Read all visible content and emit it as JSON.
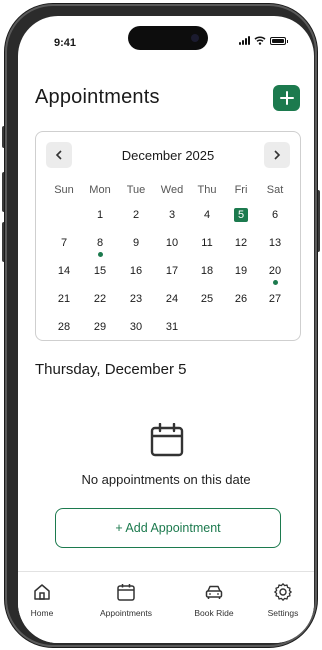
{
  "status_bar": {
    "time": "9:41"
  },
  "header": {
    "title": "Appointments",
    "add_icon": "plus-icon",
    "accent": "#1c7a4e"
  },
  "calendar": {
    "month_label": "December 2025",
    "prev_icon": "chevron-left-icon",
    "next_icon": "chevron-right-icon",
    "weekdays": [
      "Sun",
      "Mon",
      "Tue",
      "Wed",
      "Thu",
      "Fri",
      "Sat"
    ],
    "weeks": [
      [
        "",
        "1",
        "2",
        "3",
        "4",
        "5",
        "6"
      ],
      [
        "7",
        "8",
        "9",
        "10",
        "11",
        "12",
        "13"
      ],
      [
        "14",
        "15",
        "16",
        "17",
        "18",
        "19",
        "20"
      ],
      [
        "21",
        "22",
        "23",
        "24",
        "25",
        "26",
        "27"
      ],
      [
        "28",
        "29",
        "30",
        "31",
        "",
        "",
        ""
      ]
    ],
    "selected_day": "5",
    "days_with_appointments": [
      "8",
      "20"
    ]
  },
  "selected_date_label": "Thursday, December 5",
  "empty_state": {
    "icon": "calendar-icon",
    "message": "No appointments on this date"
  },
  "add_appointment_button": "+ Add Appointment",
  "tab_bar": [
    {
      "label": "Home",
      "icon": "home-icon"
    },
    {
      "label": "Appointments",
      "icon": "calendar-icon"
    },
    {
      "label": "Book Ride",
      "icon": "car-icon"
    },
    {
      "label": "Settings",
      "icon": "gear-icon"
    }
  ]
}
